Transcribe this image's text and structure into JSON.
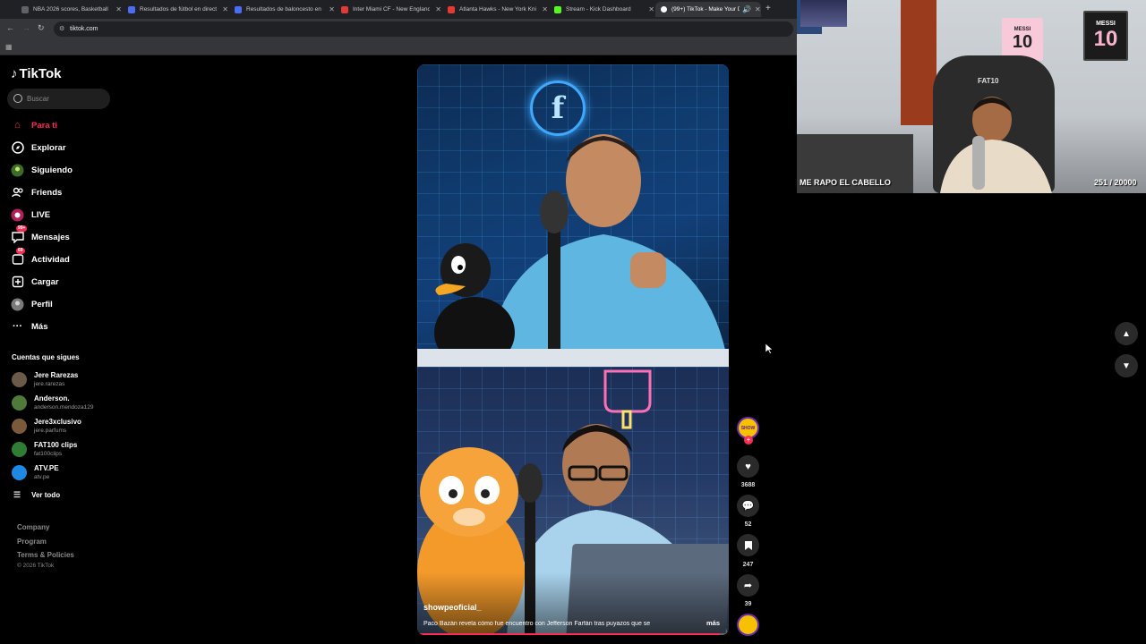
{
  "browser": {
    "tabs": [
      {
        "title": "NBA 2026 scores, Basketball US",
        "favicon_color": "#5f6368"
      },
      {
        "title": "Resultados de fútbol en directo",
        "favicon_color": "#4a6cf7"
      },
      {
        "title": "Resultados de baloncesto en di",
        "favicon_color": "#4a6cf7"
      },
      {
        "title": "Inter Miami CF - New England",
        "favicon_color": "#e53935"
      },
      {
        "title": "Atlanta Hawks - New York Knick",
        "favicon_color": "#e53935"
      },
      {
        "title": "Stream - Kick Dashboard",
        "favicon_color": "#53fc18"
      },
      {
        "title": "(99+) TikTok - Make Your D",
        "favicon_color": "#ffffff"
      }
    ],
    "url": "tiktok.com"
  },
  "tiktok": {
    "logo": "TikTok",
    "search_placeholder": "Buscar",
    "nav": [
      {
        "label": "Para ti",
        "icon": "home-icon",
        "active": true
      },
      {
        "label": "Explorar",
        "icon": "compass-icon"
      },
      {
        "label": "Siguiendo",
        "icon": "following-icon"
      },
      {
        "label": "Friends",
        "icon": "friends-icon"
      },
      {
        "label": "LIVE",
        "icon": "live-icon"
      },
      {
        "label": "Mensajes",
        "icon": "messages-icon",
        "badge": "99+"
      },
      {
        "label": "Actividad",
        "icon": "activity-icon",
        "badge": "69"
      },
      {
        "label": "Cargar",
        "icon": "upload-icon"
      },
      {
        "label": "Perfil",
        "icon": "profile-icon"
      },
      {
        "label": "Más",
        "icon": "more-icon"
      }
    ],
    "following_title": "Cuentas que sigues",
    "following": [
      {
        "name": "Jere Rarezas",
        "handle": "jere.rarezas",
        "color": "#6b5a48"
      },
      {
        "name": "Anderson.",
        "handle": "anderson.mendoza129",
        "color": "#4f7a3a"
      },
      {
        "name": "Jere3xclusivo",
        "handle": "jere.parfums",
        "color": "#7a5a3a"
      },
      {
        "name": "FAT100 clips",
        "handle": "fat100clips",
        "color": "#2e7d32"
      },
      {
        "name": "ATV.PE",
        "handle": "atv.pe",
        "color": "#1e88e5"
      }
    ],
    "see_all": "Ver todo",
    "footer": [
      "Company",
      "Program",
      "Terms & Policies"
    ],
    "copyright": "© 2026 TikTok"
  },
  "video": {
    "username": "showpeoficial_",
    "description": "Paco Bazán revela cómo fue encuentro con Jefferson Farfán tras puyazos que se",
    "more": "más",
    "progress": 0.97,
    "avatar_text": "SHOW",
    "likes": "3688",
    "comments": "52",
    "saves": "247",
    "shares": "39"
  },
  "webcam": {
    "title": "ME RAPO EL CABELLO",
    "count": "251 / 20000",
    "poster1": {
      "top": "MESSI",
      "number": "10"
    },
    "poster2": {
      "top": "MESSI",
      "number": "10"
    },
    "chair_text": "FAT10"
  }
}
